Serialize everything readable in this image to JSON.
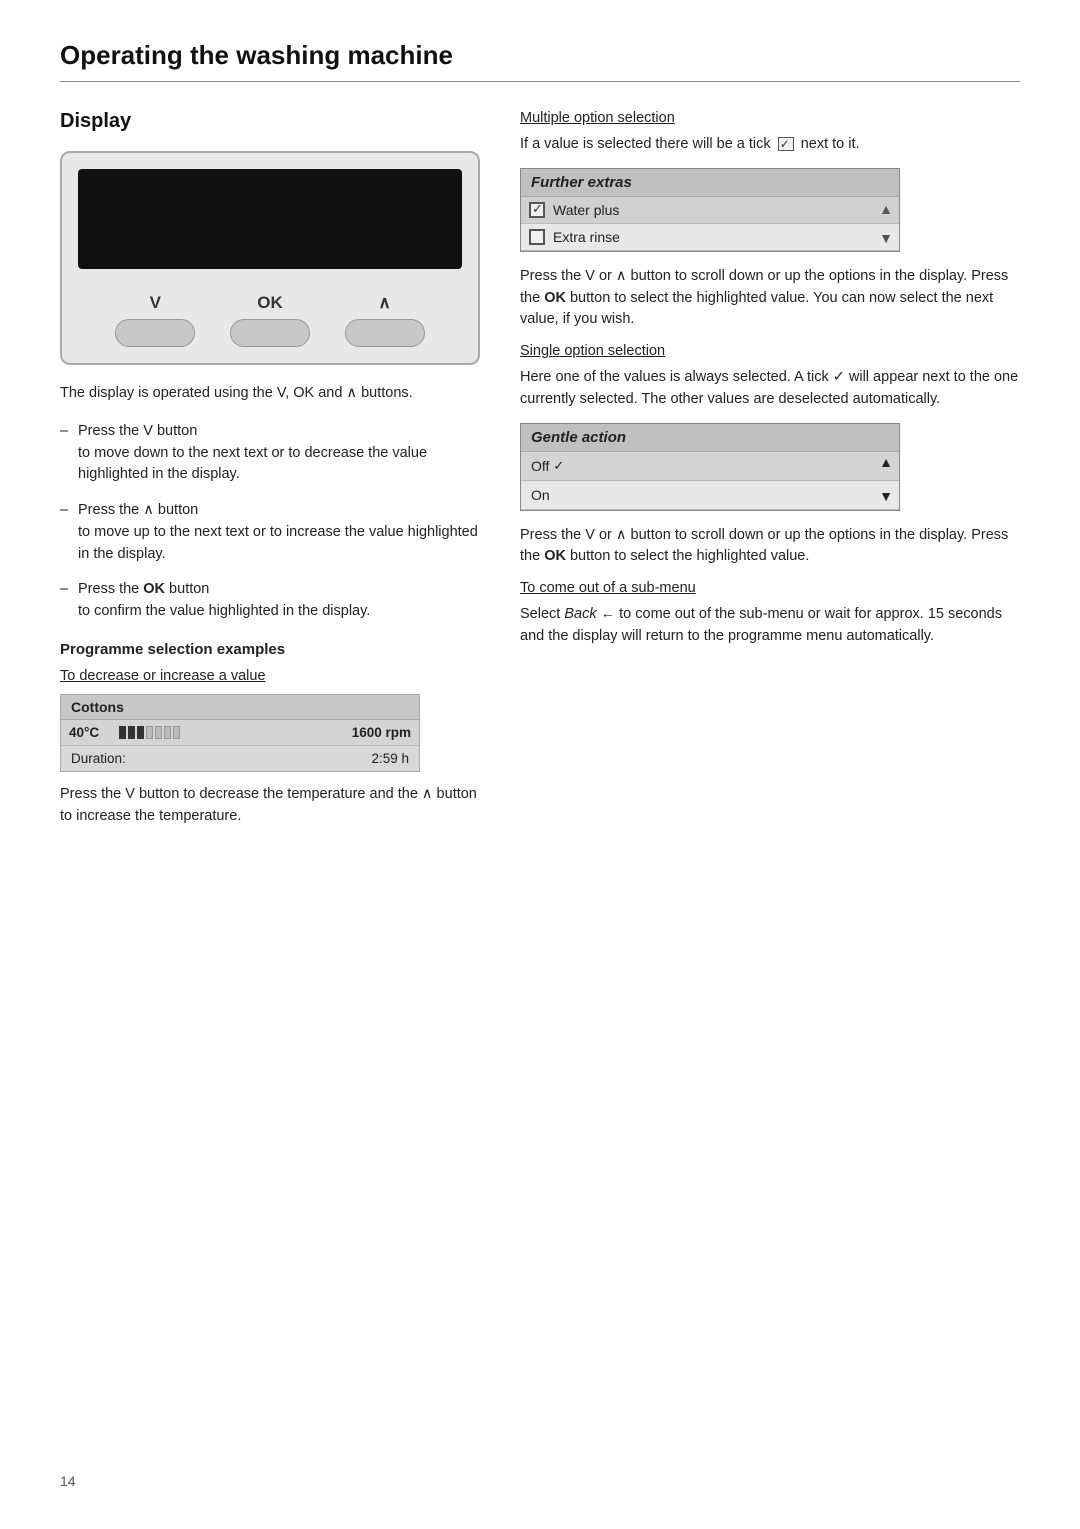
{
  "page": {
    "title": "Operating the washing machine",
    "page_number": "14"
  },
  "left": {
    "section_title": "Display",
    "buttons": {
      "v_label": "V",
      "ok_label": "OK",
      "lambda_label": "∧"
    },
    "display_desc": "The display is operated using the V, OK and ∧ buttons.",
    "bullets": [
      {
        "intro": "Press the V button",
        "detail": "to move down to the next text or to decrease the value highlighted in the display."
      },
      {
        "intro": "Press the ∧ button",
        "detail": "to move up to the next text or to increase the value highlighted in the display."
      },
      {
        "intro": "Press the OK button",
        "detail": "to confirm the value highlighted in the display."
      }
    ],
    "programme": {
      "subsection_title": "Programme selection examples",
      "decrease_heading": "To decrease or increase a value",
      "cottons_label": "Cottons",
      "temp_label": "40°C",
      "rpm_label": "1600 rpm",
      "duration_label": "Duration:",
      "duration_value": "2:59 h",
      "desc_text": "Press the V button to decrease the temperature and the ∧ button to increase the temperature."
    }
  },
  "right": {
    "multiple_option": {
      "heading": "Multiple option selection",
      "desc": "If a value is selected there will be a tick",
      "desc2": "next to it.",
      "further_extras_label": "Further extras",
      "water_plus_label": "Water plus",
      "extra_rinse_label": "Extra rinse",
      "body_text": "Press the V or ∧ button to scroll down or up the options in the display. Press the OK button to select the highlighted value. You can now select the next value, if you wish."
    },
    "single_option": {
      "heading": "Single option selection",
      "desc": "Here one of the values is always selected. A tick ✓ will appear next to the one currently selected. The other values are deselected automatically.",
      "gentle_action_label": "Gentle action",
      "off_label": "Off",
      "off_tick": "✓",
      "on_label": "On",
      "body_text": "Press the V or ∧ button to scroll down or up the options in the display. Press the OK button to select the highlighted value."
    },
    "sub_menu": {
      "heading": "To come out of a sub-menu",
      "desc": "Select Back ← to come out of the sub-menu or wait for approx. 15 seconds and the display will return to the programme menu automatically."
    }
  }
}
